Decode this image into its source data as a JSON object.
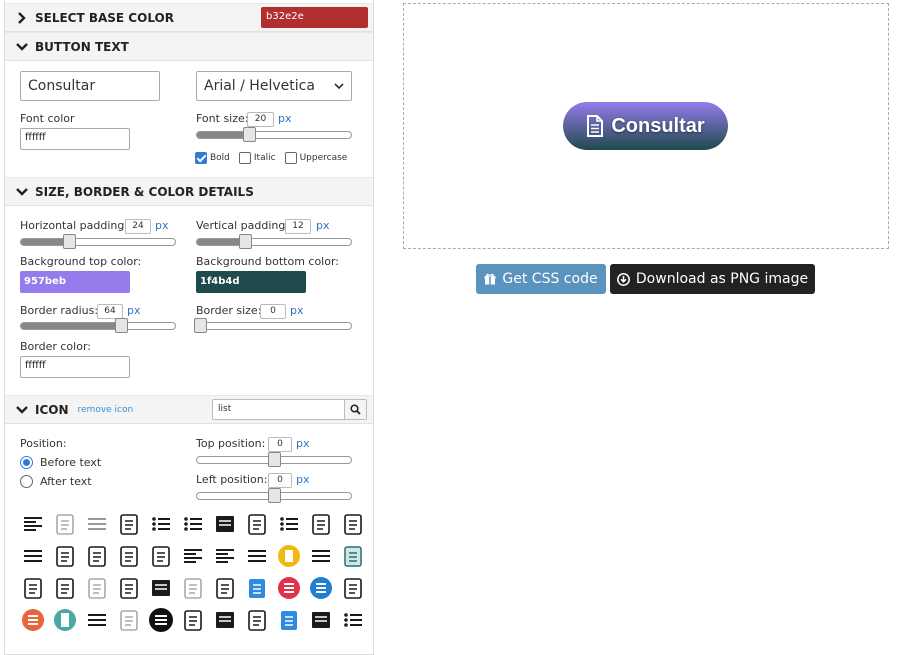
{
  "sections": {
    "base_color": {
      "title": "SELECT BASE COLOR",
      "value": "b32e2e",
      "color": "#b32e2e"
    },
    "button_text": {
      "title": "BUTTON TEXT",
      "text_value": "Consultar",
      "font_family": "Arial / Helvetica",
      "font_color_label": "Font color",
      "font_color_value": "ffffff",
      "font_size_label": "Font size:",
      "font_size_value": "20",
      "unit": "px",
      "bold_label": "Bold",
      "italic_label": "Italic",
      "uppercase_label": "Uppercase",
      "bold_checked": true,
      "italic_checked": false,
      "uppercase_checked": false
    },
    "size_border": {
      "title": "SIZE, BORDER & COLOR DETAILS",
      "h_padding_label": "Horizontal padding:",
      "h_padding_value": "24",
      "v_padding_label": "Vertical padding:",
      "v_padding_value": "12",
      "bg_top_label": "Background top color:",
      "bg_top_value": "957beb",
      "bg_top_color": "#957beb",
      "bg_bottom_label": "Background bottom color:",
      "bg_bottom_value": "1f4b4d",
      "bg_bottom_color": "#1f4b4d",
      "radius_label": "Border radius:",
      "radius_value": "64",
      "border_size_label": "Border size:",
      "border_size_value": "0",
      "border_color_label": "Border color:",
      "border_color_value": "ffffff",
      "unit": "px"
    },
    "icon": {
      "title": "ICON",
      "remove_label": "remove icon",
      "search_value": "list",
      "position_label": "Position:",
      "before_label": "Before text",
      "after_label": "After text",
      "position_selected": "Before text",
      "top_label": "Top position:",
      "top_value": "0",
      "left_label": "Left position:",
      "left_value": "0",
      "unit": "px"
    }
  },
  "preview": {
    "button_label": "Consultar",
    "button_icon": "document-icon"
  },
  "actions": {
    "css_label": "Get CSS code",
    "css_color": "#5b93bf",
    "png_label": "Download as PNG image",
    "png_color": "#222222"
  },
  "icon_grid": [
    [
      "align-left-icon",
      "document-edit-icon",
      "list-lines-icon",
      "clipboard-list-icon",
      "list-check-icon",
      "list-color-icon",
      "list-solid-icon",
      "clipboard-icon",
      "list-bullets-icon",
      "ledger-icon",
      "document-pen-icon"
    ],
    [
      "filter-lines-icon",
      "signature-icon",
      "mail-list-icon",
      "mail-list-alt-icon",
      "newspaper-icon",
      "align-center-icon",
      "align-justify-icon",
      "rows-icon",
      "clipboard-orange-icon",
      "menu-lines-icon",
      "clipboard-teal-icon"
    ],
    [
      "report-icon",
      "bill-icon",
      "clipboard-outline-icon",
      "report-alt-icon",
      "terminal-icon",
      "notes-light-icon",
      "clipboard-check-icon",
      "clipboard-blue-icon",
      "list-red-circle-icon",
      "list-blue-circle-icon",
      "document-write-icon"
    ],
    [
      "list-orange-circle-icon",
      "list-teal-circle-icon",
      "menu-icon",
      "clipboard-light-icon",
      "list-black-circle-icon",
      "id-card-icon",
      "document-dark-icon",
      "printer-icon",
      "document-blue-icon",
      "table-icon",
      "list-check-bullets-icon"
    ]
  ]
}
